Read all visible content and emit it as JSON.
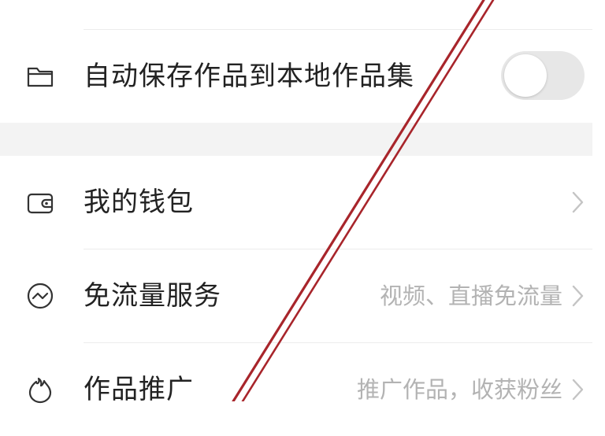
{
  "settings": {
    "items": [
      {
        "label": "自动保存作品到本地作品集",
        "icon": "folder-icon",
        "toggle_on": false
      },
      {
        "label": "我的钱包",
        "icon": "wallet-icon",
        "subtitle": ""
      },
      {
        "label": "免流量服务",
        "icon": "data-free-icon",
        "subtitle": "视频、直播免流量"
      },
      {
        "label": "作品推广",
        "icon": "flame-icon",
        "subtitle": "推广作品，收获粉丝"
      }
    ]
  },
  "colors": {
    "annotation_line": "#a8252b",
    "toggle_off": "#e7e7e7",
    "section_gap": "#f3f3f3",
    "subtitle": "#b3b3b3"
  }
}
